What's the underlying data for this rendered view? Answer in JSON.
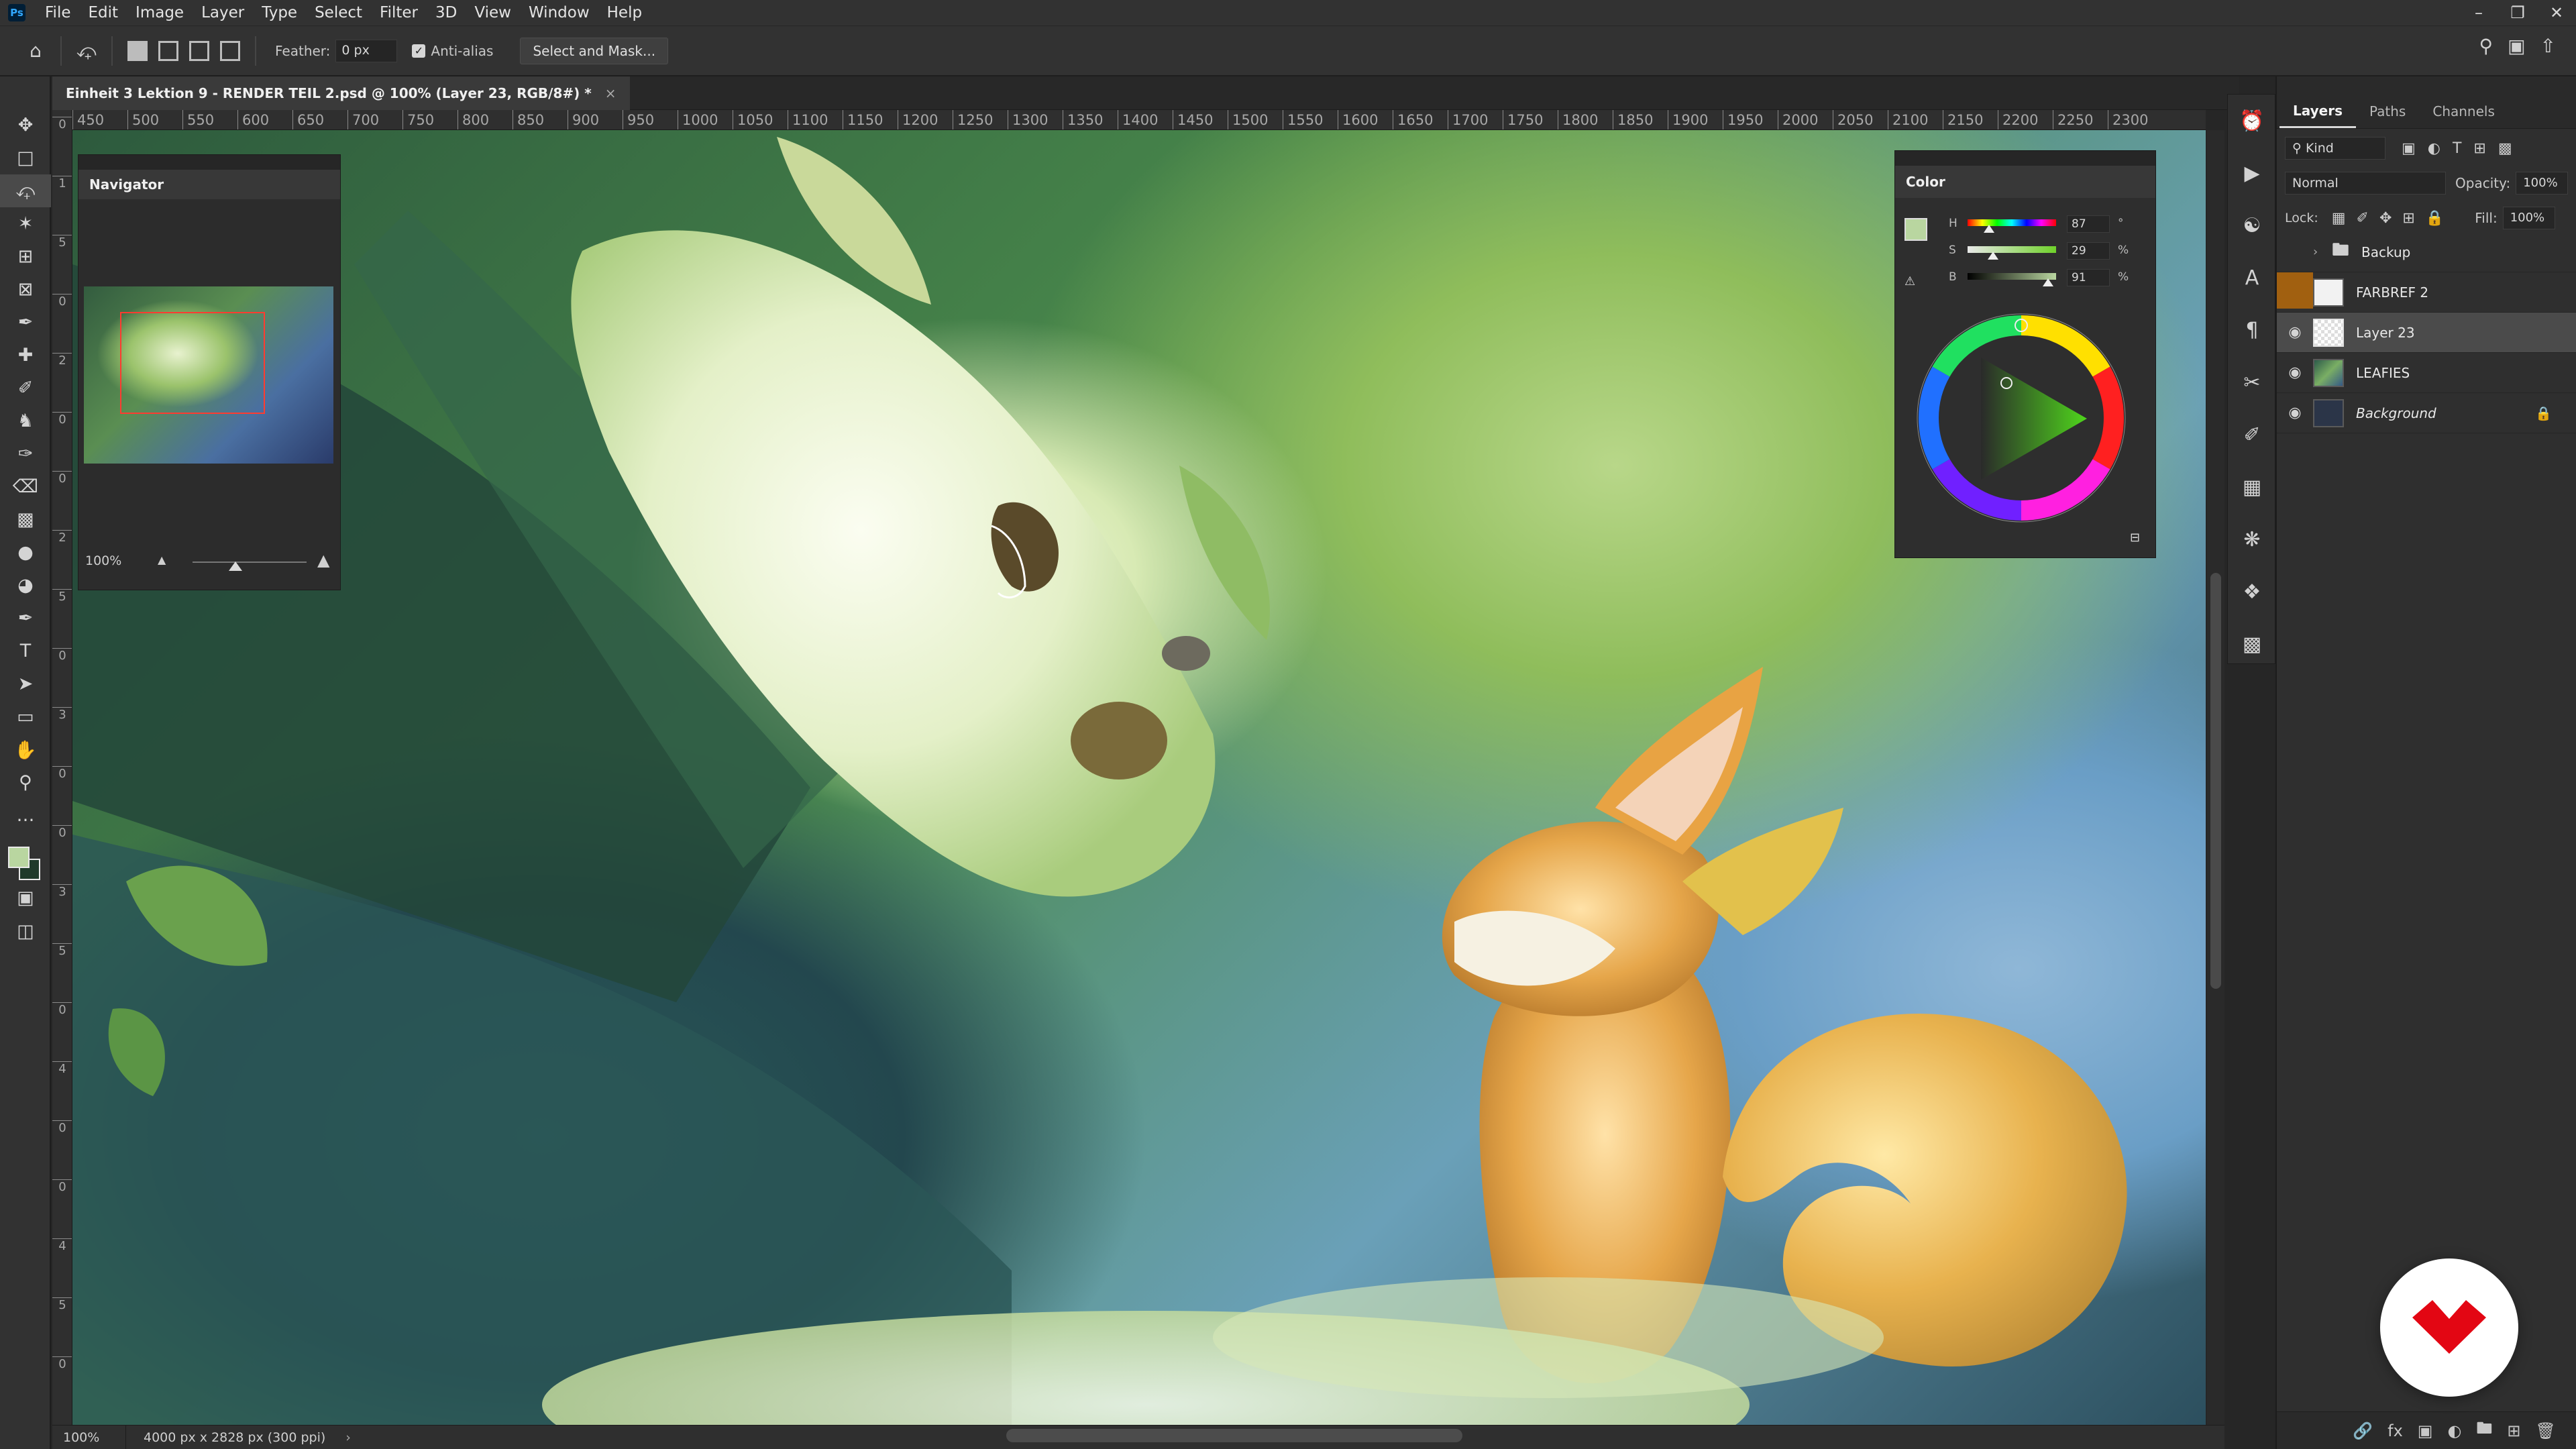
{
  "menubar": {
    "app_icon": "Ps",
    "items": [
      "File",
      "Edit",
      "Image",
      "Layer",
      "Type",
      "Select",
      "Filter",
      "3D",
      "View",
      "Window",
      "Help"
    ]
  },
  "options": {
    "feather_label": "Feather:",
    "feather_value": "0 px",
    "antialias_label": "Anti-alias",
    "select_mask_label": "Select and Mask..."
  },
  "document": {
    "tab_title": "Einheit 3 Lektion 9 - RENDER TEIL 2.psd @ 100% (Layer 23, RGB/8#) *",
    "close": "×"
  },
  "ruler": {
    "h_ticks": [
      "450",
      "500",
      "550",
      "600",
      "650",
      "700",
      "750",
      "800",
      "850",
      "900",
      "950",
      "1000",
      "1050",
      "1100",
      "1150",
      "1200",
      "1250",
      "1300",
      "1350",
      "1400",
      "1450",
      "1500",
      "1550",
      "1600",
      "1650",
      "1700",
      "1750",
      "1800",
      "1850",
      "1900",
      "1950",
      "2000",
      "2050",
      "2100",
      "2150",
      "2200",
      "2250",
      "2300"
    ],
    "v_ticks": [
      "0",
      "1",
      "5",
      "0",
      "2",
      "0",
      "0",
      "2",
      "5",
      "0",
      "3",
      "0",
      "0",
      "3",
      "5",
      "0",
      "4",
      "0",
      "0",
      "4",
      "5",
      "0"
    ]
  },
  "navigator": {
    "title": "Navigator",
    "zoom": "100%"
  },
  "color_panel": {
    "title": "Color",
    "h": {
      "label": "H",
      "value": "87",
      "unit": "°",
      "fraction": 0.24
    },
    "s": {
      "label": "S",
      "value": "29",
      "unit": "%",
      "fraction": 0.29
    },
    "b": {
      "label": "B",
      "value": "91",
      "unit": "%",
      "fraction": 0.91
    },
    "foreground": "#b9d6a0",
    "background": "#1f3a2a"
  },
  "layers_panel": {
    "tabs": [
      "Layers",
      "Paths",
      "Channels"
    ],
    "filter_kind": "Kind",
    "blend_mode": "Normal",
    "opacity_label": "Opacity:",
    "opacity_value": "100%",
    "lock_label": "Lock:",
    "fill_label": "Fill:",
    "fill_value": "100%",
    "layers": [
      {
        "name": "Backup",
        "type": "group",
        "visible": false
      },
      {
        "name": "FARBREF 2",
        "type": "layer",
        "visible": false
      },
      {
        "name": "Layer 23",
        "type": "layer",
        "visible": true,
        "active": true
      },
      {
        "name": "LEAFIES",
        "type": "layer",
        "visible": true
      },
      {
        "name": "Background",
        "type": "background",
        "visible": true,
        "locked": true
      }
    ]
  },
  "status": {
    "zoom": "100%",
    "doc_size": "4000 px x 2828 px (300 ppi)"
  },
  "colors": {
    "accent_red": "#e30613",
    "proxy_red": "#ff3b30"
  }
}
